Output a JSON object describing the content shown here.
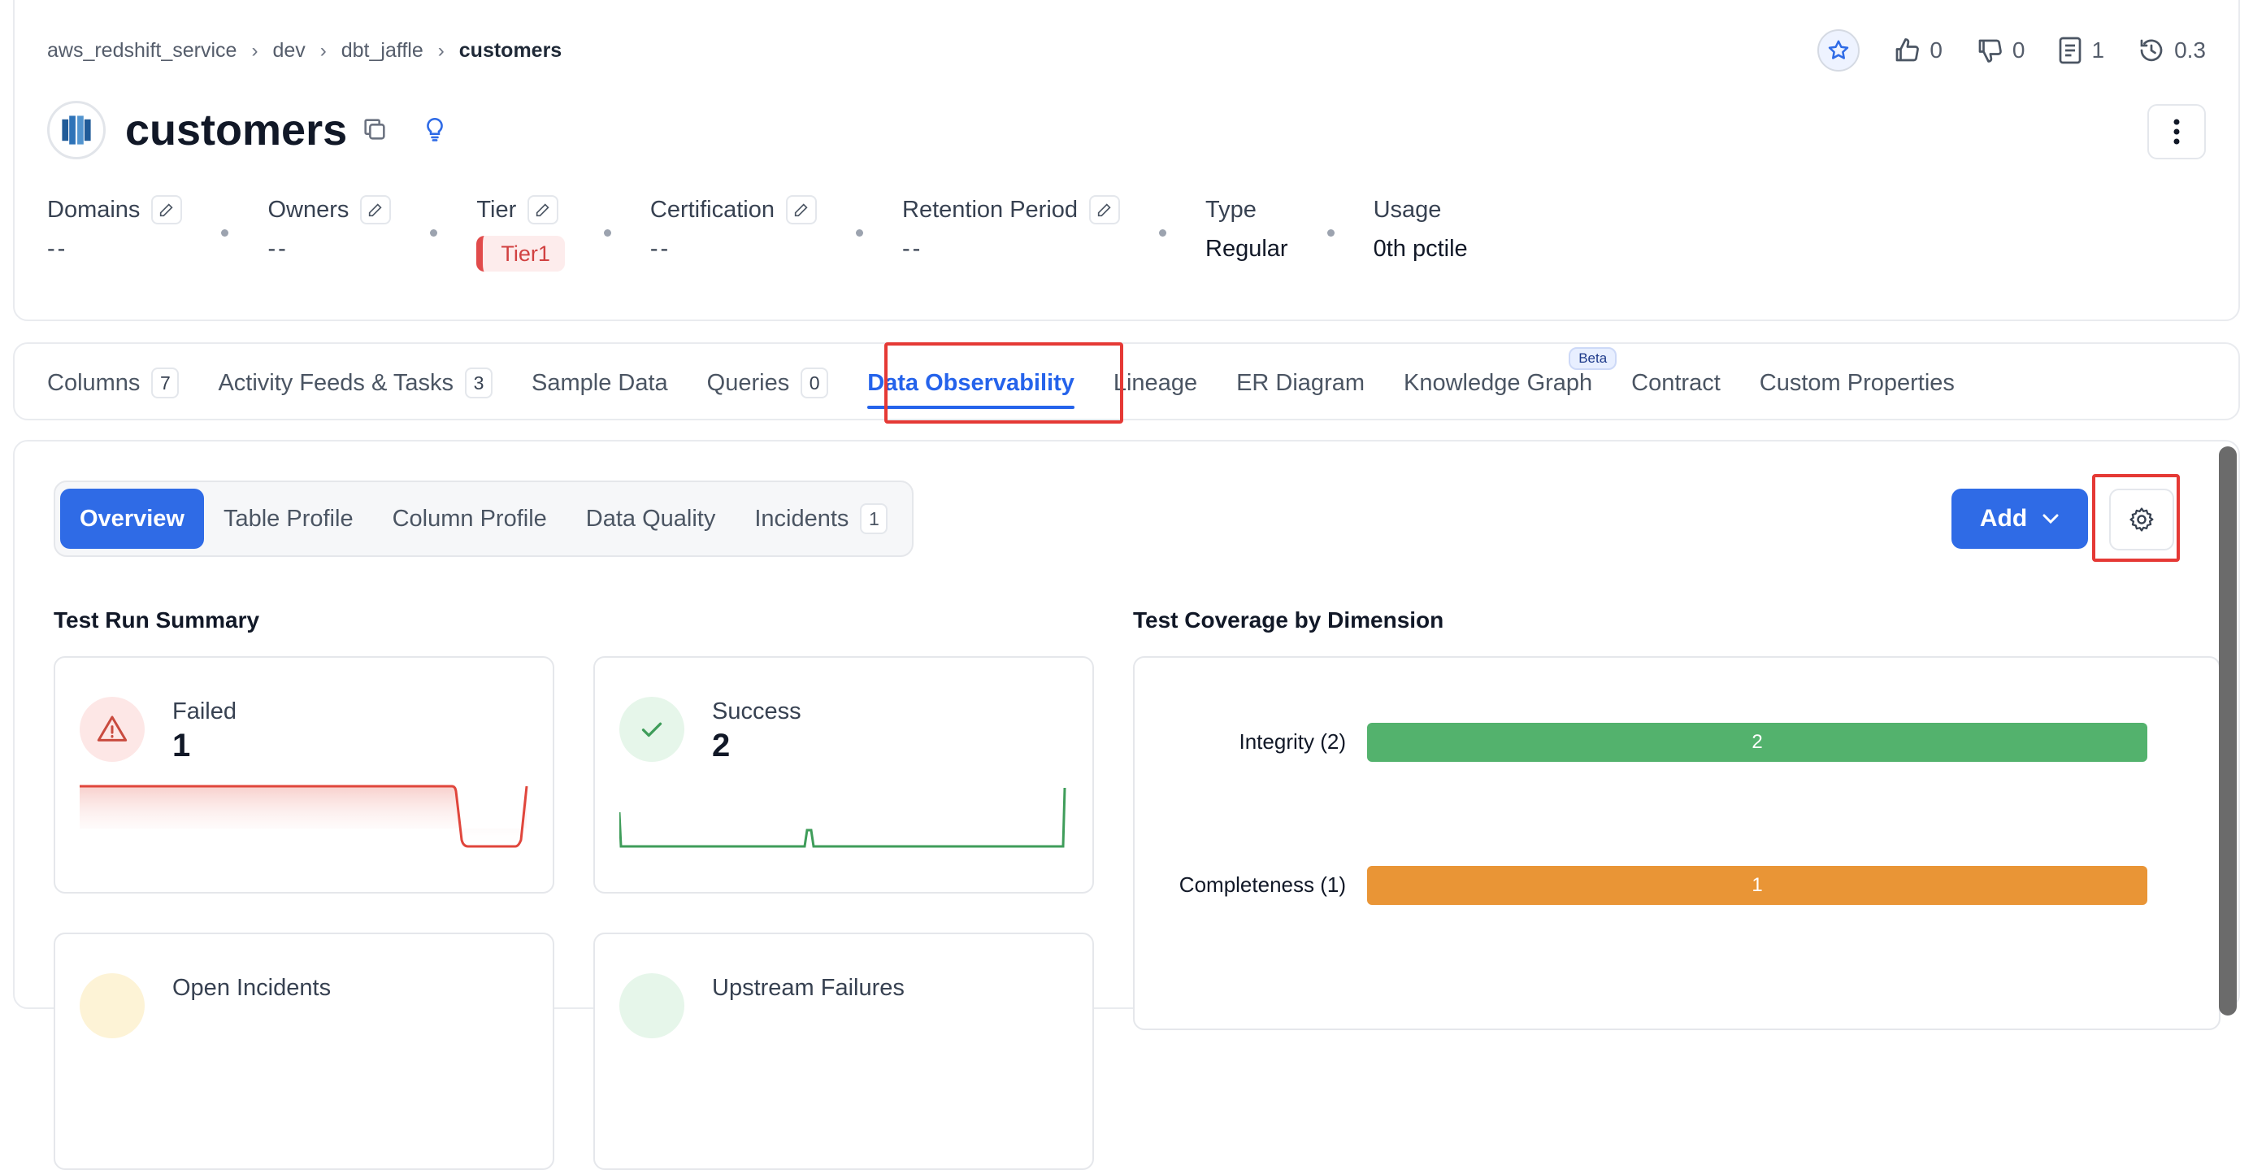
{
  "breadcrumb": [
    "aws_redshift_service",
    "dev",
    "dbt_jaffle",
    "customers"
  ],
  "header_actions": {
    "likes": "0",
    "dislikes": "0",
    "docs": "1",
    "version": "0.3"
  },
  "entity": {
    "name": "customers"
  },
  "meta": {
    "domains": {
      "label": "Domains",
      "value": "--"
    },
    "owners": {
      "label": "Owners",
      "value": "--"
    },
    "tier": {
      "label": "Tier",
      "value": "Tier1"
    },
    "certification": {
      "label": "Certification",
      "value": "--"
    },
    "retention": {
      "label": "Retention Period",
      "value": "--"
    },
    "type": {
      "label": "Type",
      "value": "Regular"
    },
    "usage": {
      "label": "Usage",
      "value": "0th pctile"
    }
  },
  "tabs": [
    {
      "label": "Columns",
      "count": "7"
    },
    {
      "label": "Activity Feeds & Tasks",
      "count": "3"
    },
    {
      "label": "Sample Data"
    },
    {
      "label": "Queries",
      "count": "0"
    },
    {
      "label": "Data Observability",
      "active": true
    },
    {
      "label": "Lineage"
    },
    {
      "label": "ER Diagram"
    },
    {
      "label": "Knowledge Graph",
      "badge": "Beta"
    },
    {
      "label": "Contract"
    },
    {
      "label": "Custom Properties"
    }
  ],
  "subtabs": [
    {
      "label": "Overview",
      "active": true
    },
    {
      "label": "Table Profile"
    },
    {
      "label": "Column Profile"
    },
    {
      "label": "Data Quality"
    },
    {
      "label": "Incidents",
      "count": "1"
    }
  ],
  "add_button": "Add",
  "test_run_summary": {
    "title": "Test Run Summary",
    "cards": {
      "failed": {
        "label": "Failed",
        "value": "1"
      },
      "success": {
        "label": "Success",
        "value": "2"
      },
      "open_incidents": {
        "label": "Open Incidents"
      },
      "upstream_failures": {
        "label": "Upstream Failures"
      }
    }
  },
  "coverage": {
    "title": "Test Coverage by Dimension",
    "rows": [
      {
        "label": "Integrity (2)",
        "value": "2",
        "color": "#53b26d"
      },
      {
        "label": "Completeness (1)",
        "value": "1",
        "color": "#e99536"
      }
    ]
  },
  "colors": {
    "accent": "#2f6be6",
    "highlight": "#e53935",
    "failed": "#e0463c",
    "success": "#3f9d5a"
  }
}
